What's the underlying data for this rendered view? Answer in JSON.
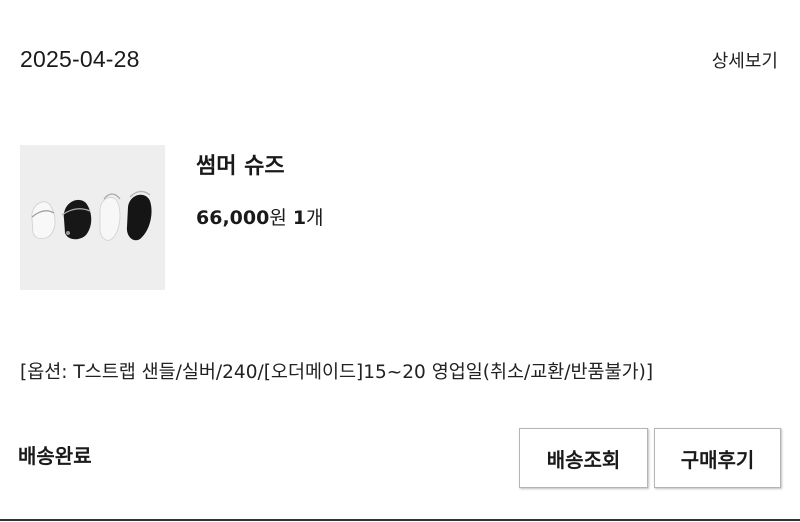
{
  "order": {
    "date": "2025-04-28",
    "detail_link": "상세보기"
  },
  "product": {
    "name": "썸머 슈즈",
    "price": "66,000",
    "price_unit": "원",
    "quantity": "1",
    "quantity_unit": "개",
    "thumbnail_icon": "sandals-product-image"
  },
  "options_text": "[옵션: T스트랩 샌들/실버/240/[오더메이드]15~20 영업일(취소/교환/반품불가)]",
  "status": "배송완료",
  "buttons": {
    "track": "배송조회",
    "review": "구매후기"
  }
}
